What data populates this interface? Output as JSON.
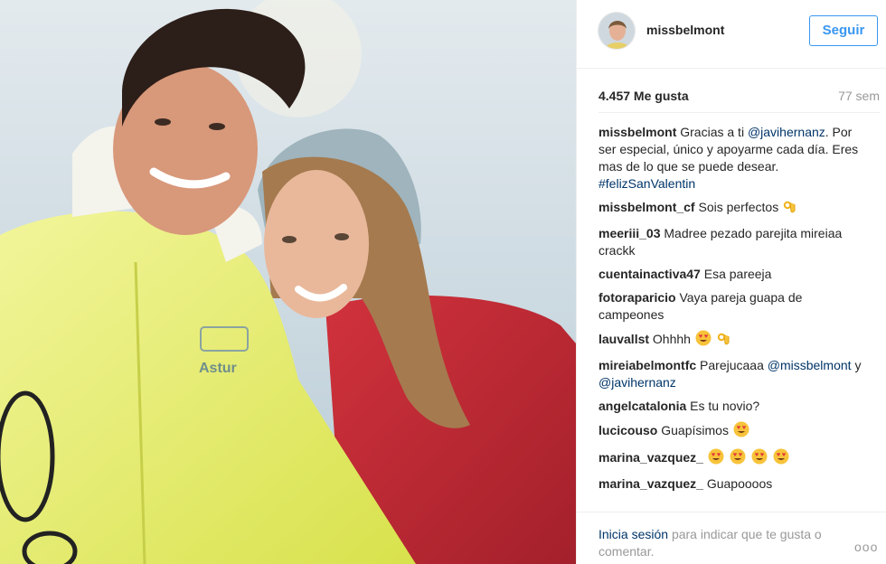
{
  "post": {
    "username": "missbelmont",
    "follow_label": "Seguir",
    "likes": "4.457 Me gusta",
    "time": "77 sem"
  },
  "caption": {
    "user": "missbelmont",
    "text_1": "Gracias a ti",
    "mention": "@javihernanz",
    "text_2": ". Por ser especial, único y apoyarme cada día. Eres mas de lo que se puede desear.",
    "hashtag": "#felizSanValentin"
  },
  "comments": [
    {
      "user": "missbelmont_cf",
      "text": "Sois perfectos"
    },
    {
      "user": "meeriii_03",
      "text": "Madree pezado parejita mireiaa crackk"
    },
    {
      "user": "cuentainactiva47",
      "text": "Esa pareeja"
    },
    {
      "user": "fotoraparicio",
      "text": "Vaya pareja guapa de campeones"
    },
    {
      "user": "lauvallst",
      "text": "Ohhhh"
    },
    {
      "user": "mireiabelmontfc",
      "text": "Parejucaaa",
      "mention_1": "@missbelmont",
      "conj": "y",
      "mention_2": "@javihernanz"
    },
    {
      "user": "angelcatalonia",
      "text": "Es tu novio?"
    },
    {
      "user": "lucicouso",
      "text": "Guapísimos"
    },
    {
      "user": "marina_vazquez_",
      "text": ""
    },
    {
      "user": "marina_vazquez_",
      "text": "Guapoooos"
    }
  ],
  "footer": {
    "login_link": "Inicia sesión",
    "login_rest": "para indicar que te gusta o comentar.",
    "more": "ooo"
  },
  "photo": {
    "jacket_text": "Astur"
  },
  "colors": {
    "link_blue": "#003569",
    "accent_blue": "#3897f0",
    "jacket_yellow": "#eaf06a",
    "jacket_red": "#c0262f"
  }
}
